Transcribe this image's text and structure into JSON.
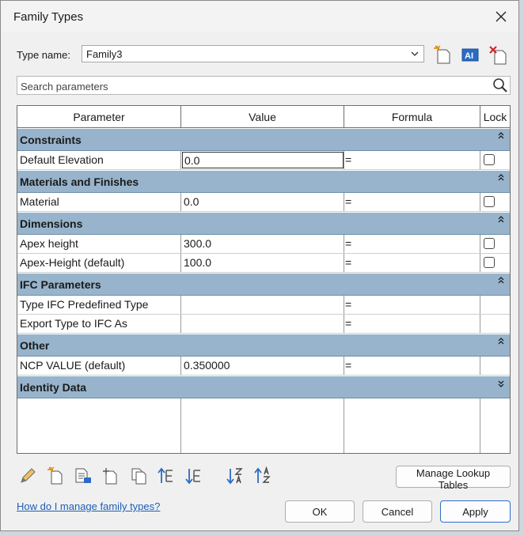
{
  "window": {
    "title": "Family Types"
  },
  "type_name": {
    "label": "Type name:",
    "value": "Family3"
  },
  "search": {
    "placeholder": "Search parameters"
  },
  "columns": [
    "Parameter",
    "Value",
    "Formula",
    "Lock"
  ],
  "groups": {
    "constraints": "Constraints",
    "materials": "Materials and Finishes",
    "dimensions": "Dimensions",
    "ifc": "IFC Parameters",
    "other": "Other",
    "identity": "Identity Data"
  },
  "rows": {
    "default_elevation": {
      "name": "Default Elevation",
      "value": "0.0",
      "formula": "="
    },
    "material": {
      "name": "Material",
      "value": "0.0",
      "formula": "="
    },
    "apex_height": {
      "name": "Apex height",
      "value": "300.0",
      "formula": "="
    },
    "apex_height_default": {
      "name": "Apex-Height (default)",
      "value": "100.0",
      "formula": "="
    },
    "type_ifc_predefined": {
      "name": "Type IFC Predefined Type",
      "value": "",
      "formula": "="
    },
    "export_type_ifc": {
      "name": "Export Type to IFC As",
      "value": "",
      "formula": "="
    },
    "ncp_value": {
      "name": "NCP VALUE (default)",
      "value": "0.350000",
      "formula": "="
    }
  },
  "buttons": {
    "manage_lookup": "Manage Lookup Tables",
    "ok": "OK",
    "cancel": "Cancel",
    "apply": "Apply"
  },
  "help_link": "How do I manage family types?",
  "colors": {
    "group_header": "#97b4cc",
    "link": "#1d5fb5",
    "accent": "#2f6fc4"
  },
  "icons": [
    "new-type-icon",
    "rename-type-icon",
    "delete-type-icon",
    "search-icon",
    "edit-parameter-icon",
    "new-parameter-icon",
    "delete-parameter-icon",
    "shared-parameter-icon",
    "copy-parameter-icon",
    "move-up-icon",
    "move-down-icon",
    "sort-ascending-icon",
    "sort-descending-icon",
    "close-icon",
    "chevron-down-icon"
  ]
}
